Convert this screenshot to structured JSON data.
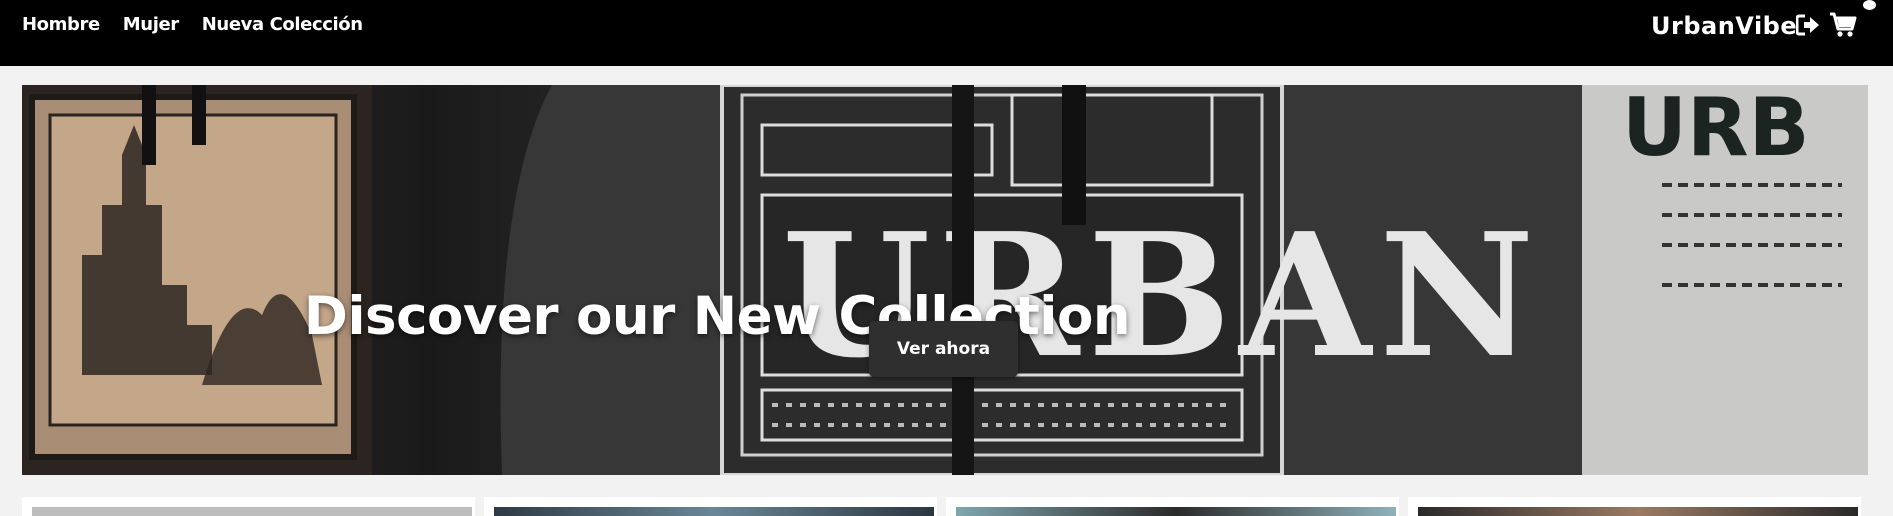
{
  "nav": {
    "links": [
      "Hombre",
      "Mujer",
      "Nueva Colección"
    ]
  },
  "brand": {
    "name": "UrbanVibe"
  },
  "icons": {
    "logout": "sign-out-icon",
    "cart": "shopping-cart-icon"
  },
  "hero": {
    "title": "Discover our New Collection",
    "button_label": "Ver ahora"
  },
  "colors": {
    "topbar": "#000000",
    "page_bg": "#f2f2f2",
    "button_bg": "#2f2f2f"
  }
}
